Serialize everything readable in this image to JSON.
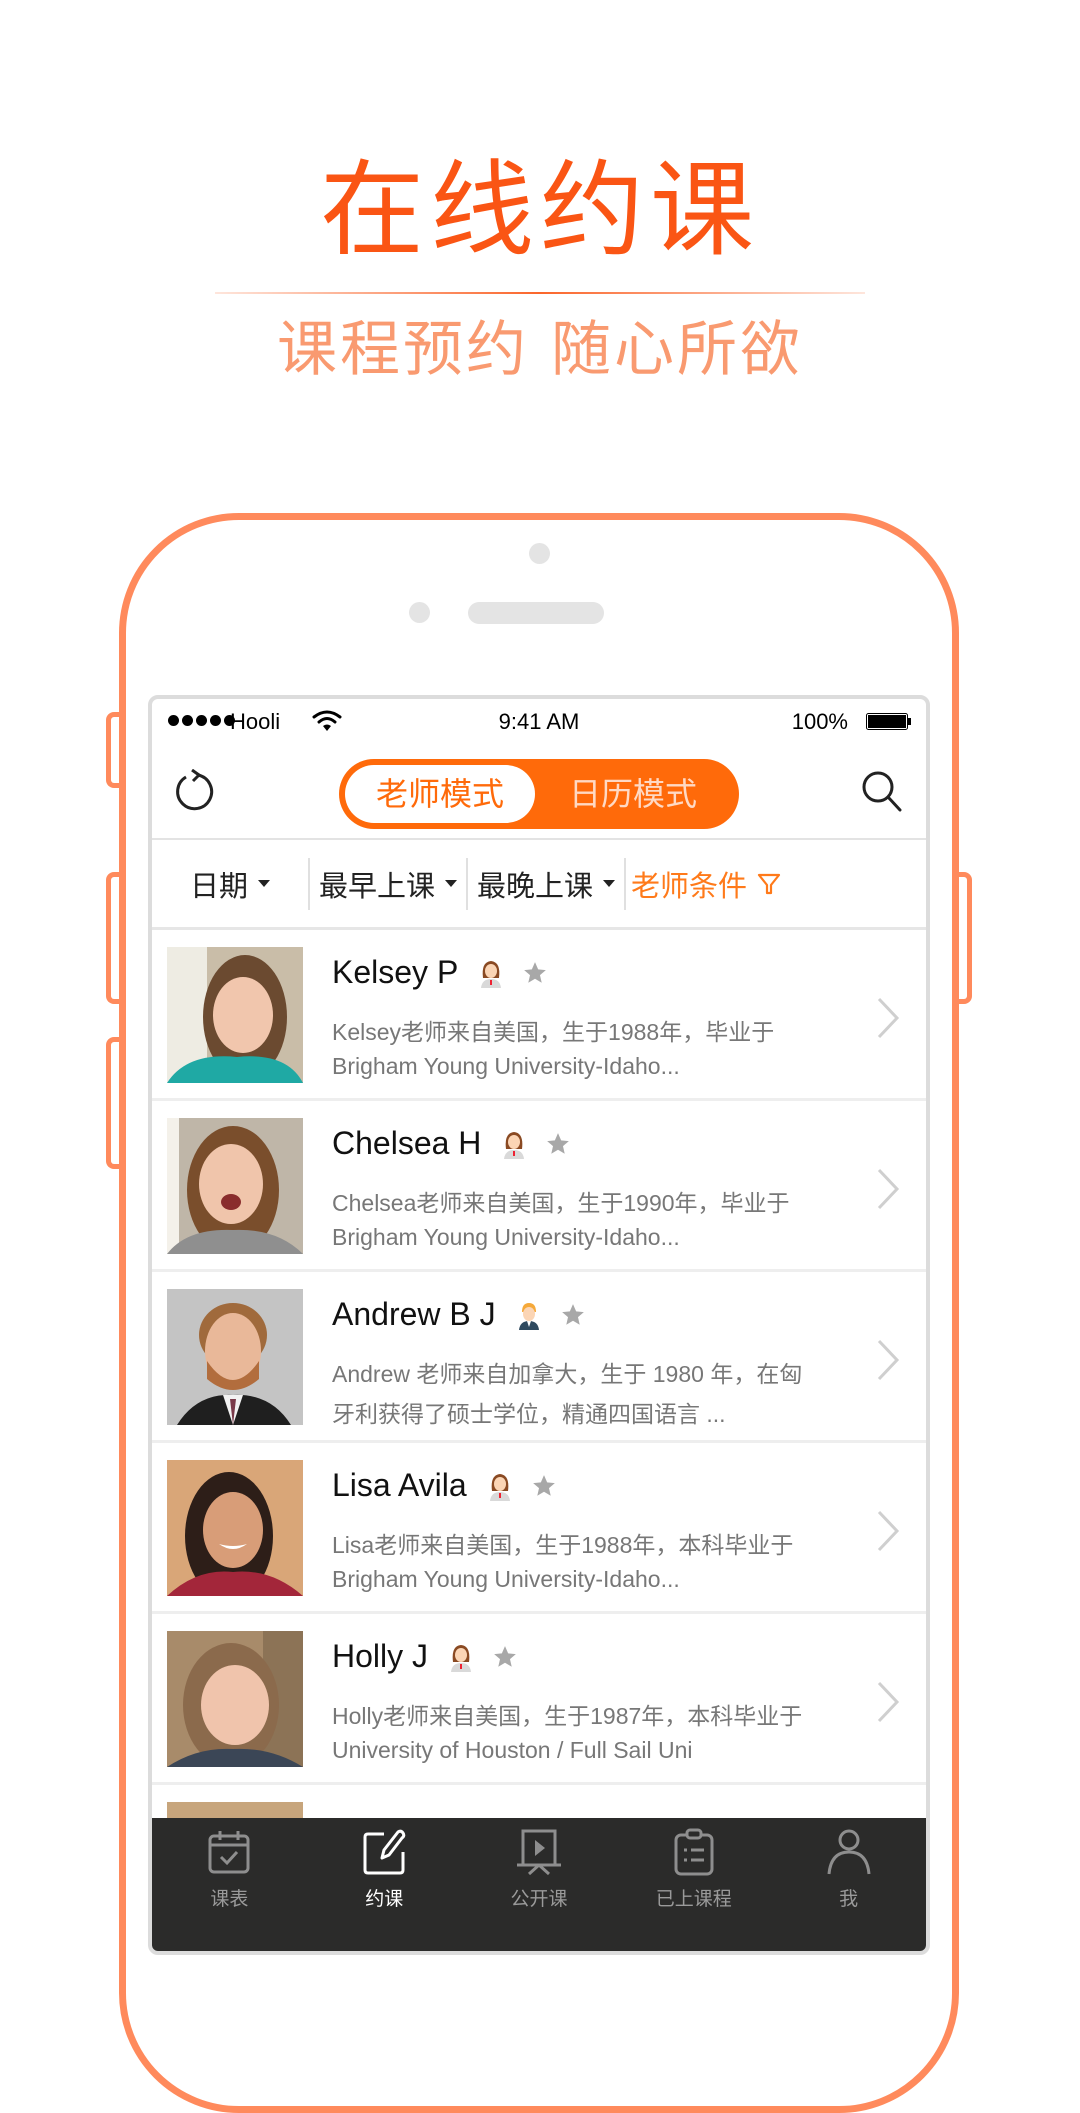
{
  "promo": {
    "title": "在线约课",
    "subtitle": "课程预约 随心所欲",
    "accent_color": "#fa5514"
  },
  "status_bar": {
    "carrier": "Hooli",
    "time": "9:41 AM",
    "battery": "100%"
  },
  "nav": {
    "refresh_icon": "refresh-icon",
    "modes": [
      {
        "label": "老师模式",
        "active": true
      },
      {
        "label": "日历模式",
        "active": false
      }
    ],
    "search_icon": "search-icon"
  },
  "filters": [
    {
      "label": "日期",
      "type": "dropdown"
    },
    {
      "label": "最早上课",
      "type": "dropdown"
    },
    {
      "label": "最晚上课",
      "type": "dropdown"
    },
    {
      "label": "老师条件",
      "type": "filter",
      "icon": "filter-icon"
    }
  ],
  "teachers": [
    {
      "name": "Kelsey P",
      "gender": "female",
      "desc1": "Kelsey老师来自美国，生于1988年，毕业于",
      "desc2": "Brigham Young University-Idaho..."
    },
    {
      "name": "Chelsea H",
      "gender": "female",
      "desc1": "Chelsea老师来自美国，生于1990年，毕业于",
      "desc2": "Brigham Young University-Idaho..."
    },
    {
      "name": "Andrew B J",
      "gender": "male",
      "desc1": "Andrew 老师来自加拿大，生于 1980 年，在匈",
      "desc2": "牙利获得了硕士学位，精通四国语言 ..."
    },
    {
      "name": "Lisa Avila",
      "gender": "female",
      "desc1": "Lisa老师来自美国，生于1988年，本科毕业于",
      "desc2": "Brigham  Young  University-Idaho..."
    },
    {
      "name": "Holly J",
      "gender": "female",
      "desc1": "Holly老师来自美国，生于1987年，本科毕业于",
      "desc2": "University of  Houston / Full Sail Uni"
    }
  ],
  "tabbar": {
    "tabs": [
      {
        "label": "课表",
        "icon": "calendar-check-icon",
        "active": false
      },
      {
        "label": "约课",
        "icon": "edit-icon",
        "active": true
      },
      {
        "label": "公开课",
        "icon": "presentation-icon",
        "active": false
      },
      {
        "label": "已上课程",
        "icon": "clipboard-list-icon",
        "active": false
      },
      {
        "label": "我",
        "icon": "user-icon",
        "active": false
      }
    ]
  }
}
